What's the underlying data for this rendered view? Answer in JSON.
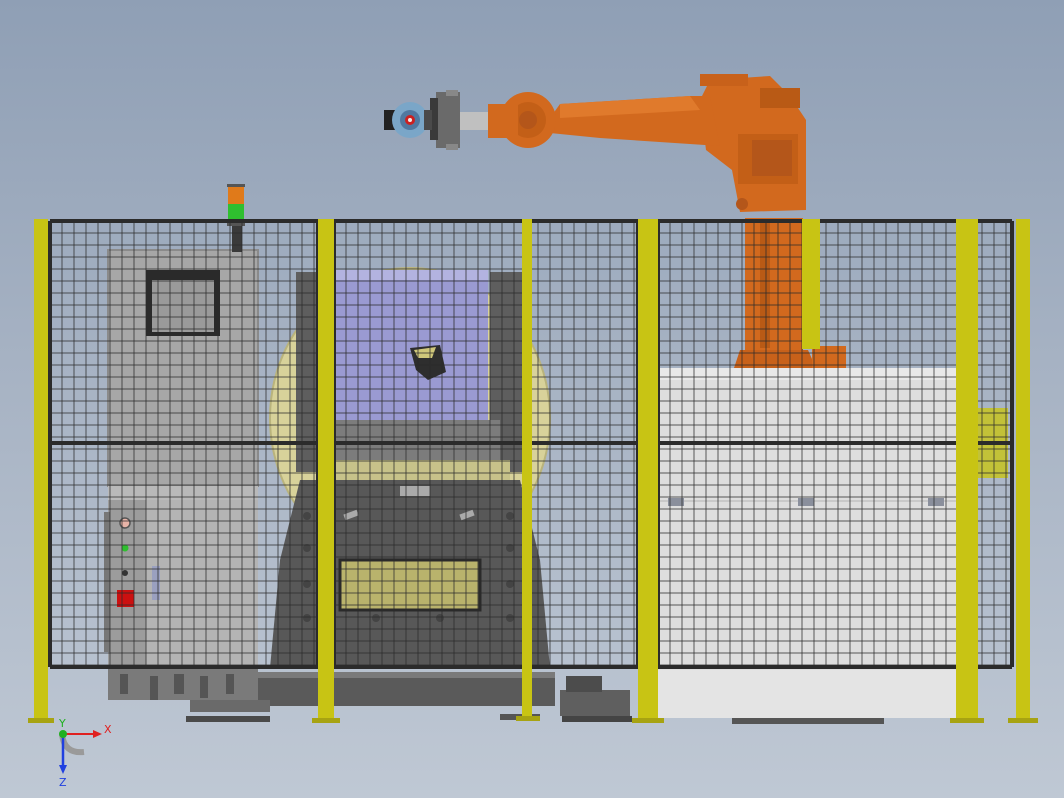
{
  "viewport": {
    "background_top": "#8f9fb5",
    "background_bottom": "#bfc8d4"
  },
  "colors": {
    "fence_post": "#c8c414",
    "fence_mesh": "#2b2b2b",
    "robot": "#d2691e",
    "cabinet": "#a9a9a9",
    "positioner_disc": "#d8d29a",
    "conveyor": "#d9d9d9"
  },
  "scene": {
    "robot_arm": {
      "icon": "industrial-robot-icon"
    },
    "stack_light": {
      "icon": "stack-light-icon",
      "colors": [
        "#e07a1a",
        "#2fbf2f"
      ]
    },
    "control_cabinet": {
      "icon": "control-cabinet-icon",
      "indicators": [
        "indicator-light-pink",
        "indicator-light-green",
        "indicator-light-black",
        "emergency-stop-red"
      ]
    },
    "positioner": {
      "icon": "welding-positioner-icon"
    },
    "conveyor_table": {
      "icon": "conveyor-table-icon"
    },
    "safety_fence": {
      "icon": "safety-fence-icon"
    }
  },
  "triad": {
    "x_label": "X",
    "y_label": "Y",
    "z_label": "Z",
    "x_color": "#e02020",
    "y_color": "#20b020",
    "z_color": "#2040e0"
  }
}
